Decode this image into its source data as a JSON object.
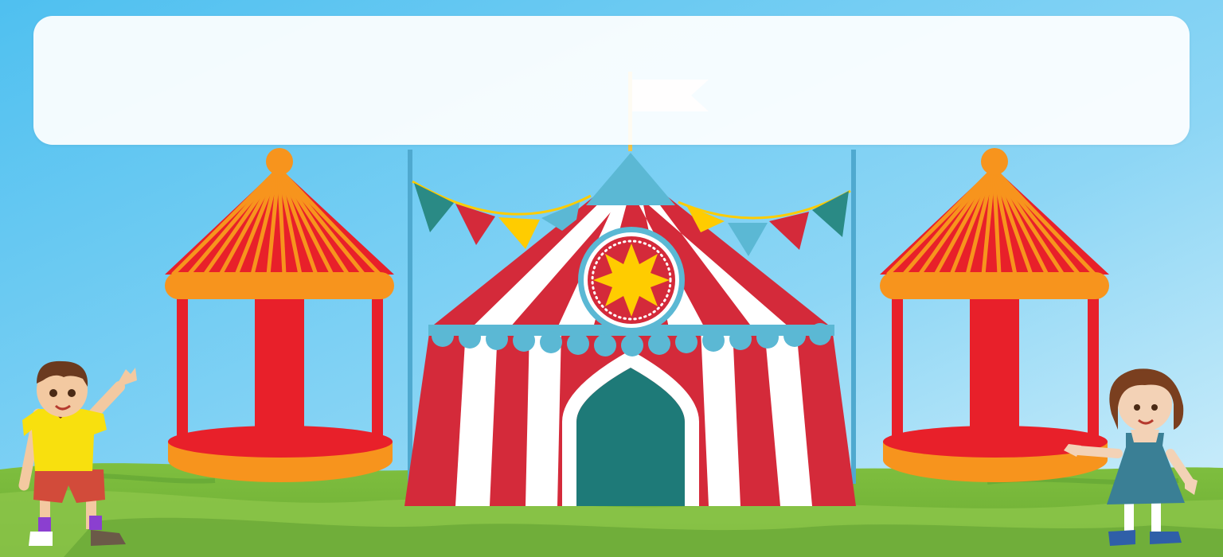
{
  "banner": {
    "text": ""
  },
  "colors": {
    "sky_top": "#58c6f2",
    "sky_bottom": "#c8ecfb",
    "grass_light": "#8bc34a",
    "grass_dark": "#5a9e32",
    "tent_red": "#d42a3a",
    "tent_white": "#ffffff",
    "tent_trim": "#5bb8d4",
    "tent_door": "#1e7a78",
    "booth_red": "#e8202a",
    "booth_orange": "#f7941d",
    "star_yellow": "#ffcc00",
    "pennant_teal": "#2a8a85",
    "pennant_red": "#d42a3a",
    "pennant_yellow": "#ffcc00",
    "pennant_blue": "#5bb8d4"
  },
  "scene": {
    "characters": [
      "boy-waving",
      "girl-waving"
    ],
    "structures": [
      "left-booth",
      "big-top-tent",
      "right-booth"
    ],
    "icons": [
      "star-icon",
      "flag-icon"
    ]
  }
}
